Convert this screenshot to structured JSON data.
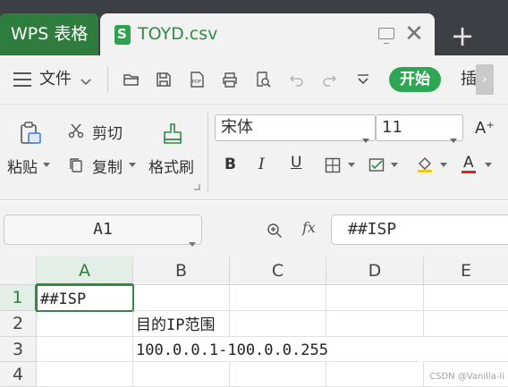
{
  "tabs": {
    "app_label": "WPS 表格",
    "doc_label": "TOYD.csv",
    "close_glyph": "✕",
    "new_tab_glyph": "+"
  },
  "menu": {
    "file_label": "文件",
    "start_label": "开始",
    "insert_label": "插",
    "scroll_glyph": "›"
  },
  "ribbon": {
    "paste_label": "粘贴",
    "cut_label": "剪切",
    "copy_label": "复制",
    "format_painter_label": "格式刷",
    "font_name": "宋体",
    "font_size": "11",
    "grow_font_label": "A⁺",
    "bold_label": "B",
    "italic_label": "I",
    "underline_label": "U",
    "font_color_label": "A"
  },
  "formula_bar": {
    "name_box": "A1",
    "fx_label": "fx",
    "formula": "##ISP"
  },
  "grid": {
    "columns": [
      "A",
      "B",
      "C",
      "D",
      "E"
    ],
    "rows": [
      "1",
      "2",
      "3",
      "4"
    ],
    "cells": {
      "A1": "##ISP",
      "B2": "目的IP范围",
      "B3": "100.0.0.1-100.0.0.255"
    }
  },
  "colors": {
    "accent_green": "#2f8a45",
    "start_button": "#2ea654",
    "titlebar": "#3c3f43"
  },
  "watermark": "CSDN @Vanilla-li"
}
